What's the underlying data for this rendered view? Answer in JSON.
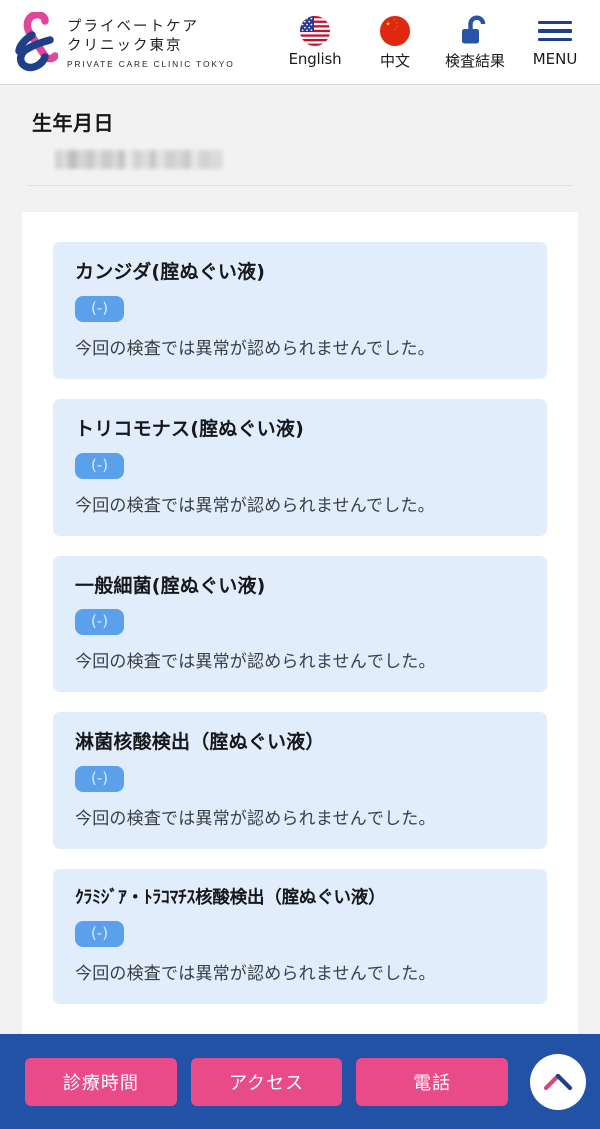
{
  "header": {
    "logo_icon": "ampersand-logo",
    "brand_line1": "プライベートケア",
    "brand_line2": "クリニック東京",
    "brand_en": "PRIVATE CARE CLINIC TOKYO",
    "nav": [
      {
        "label": "English",
        "icon": "us-flag-icon",
        "name": "nav-english"
      },
      {
        "label": "中文",
        "icon": "china-flag-icon",
        "name": "nav-chinese"
      },
      {
        "label": "検査結果",
        "icon": "open-lock-icon",
        "name": "nav-test-results"
      },
      {
        "label": "MENU",
        "icon": "hamburger-icon",
        "name": "nav-menu"
      }
    ]
  },
  "patient": {
    "birthdate_label": "生年月日",
    "birthdate_value": ""
  },
  "results": [
    {
      "name": "カンジダ(腟ぬぐい液)",
      "badge": "(-)",
      "comment": "今回の検査では異常が認められませんでした。"
    },
    {
      "name": "トリコモナス(腟ぬぐい液)",
      "badge": "(-)",
      "comment": "今回の検査では異常が認められませんでした。"
    },
    {
      "name": "一般細菌(腟ぬぐい液)",
      "badge": "(-)",
      "comment": "今回の検査では異常が認められませんでした。"
    },
    {
      "name": "淋菌核酸検出（腟ぬぐい液）",
      "badge": "(-)",
      "comment": "今回の検査では異常が認められませんでした。"
    },
    {
      "name": "ｸﾗﾐｼﾞｱ・ﾄﾗｺﾏﾁｽ核酸検出（腟ぬぐい液）",
      "badge": "(-)",
      "comment": "今回の検査では異常が認められませんでした。"
    }
  ],
  "footer": {
    "buttons": [
      {
        "label": "診療時間",
        "name": "footer-hours-button"
      },
      {
        "label": "アクセス",
        "name": "footer-access-button"
      },
      {
        "label": "電話",
        "name": "footer-phone-button"
      }
    ],
    "scroll_top_icon": "chevron-up-icon"
  },
  "colors": {
    "brand_pink": "#e84b87",
    "brand_navy": "#1f3f86",
    "footer_blue": "#2252a6",
    "card_blue": "#e1edfb",
    "badge_blue": "#5ba0ea",
    "page_gray": "#f2f2f2"
  }
}
